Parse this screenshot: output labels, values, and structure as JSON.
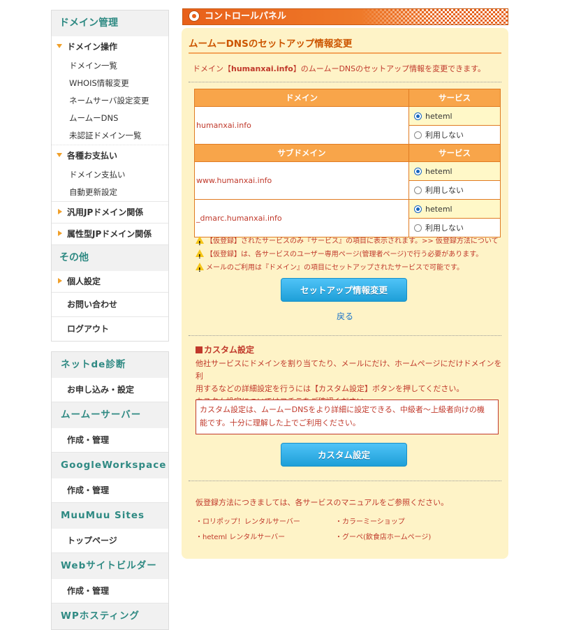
{
  "sidebar": {
    "domain_header": "ドメイン管理",
    "cat_ops": "ドメイン操作",
    "ops_items": [
      "ドメイン一覧",
      "WHOIS情報変更",
      "ネームサーバ設定変更",
      "ムームーDNS",
      "未認証ドメイン一覧"
    ],
    "cat_payment": "各種お支払い",
    "payment_items": [
      "ドメイン支払い",
      "自動更新設定"
    ],
    "cat_jp": "汎用JPドメイン関係",
    "cat_attr_jp": "属性型JPドメイン関係",
    "other_header": "その他",
    "cat_personal": "個人設定",
    "contact": "お問い合わせ",
    "logout": "ログアウト",
    "services": [
      {
        "header": "ネットde診断",
        "item": "お申し込み・設定"
      },
      {
        "header": "ムームーサーバー",
        "item": "作成・管理"
      },
      {
        "header": "GoogleWorkspace",
        "item": "作成・管理"
      },
      {
        "header": "MuuMuu Sites",
        "item": "トップページ"
      },
      {
        "header": "Webサイトビルダー",
        "item": "作成・管理"
      },
      {
        "header": "WPホスティング",
        "item": ""
      }
    ]
  },
  "main": {
    "bar_title": "コントロールパネル",
    "page_title": "ムームーDNSのセットアップ情報変更",
    "intro_pre": "ドメイン【",
    "intro_domain": "humanxai.info",
    "intro_post": "】のムームーDNSのセットアップ情報を変更できます。",
    "table": {
      "col_domain": "ドメイン",
      "col_service": "サービス",
      "col_subdomain": "サブドメイン",
      "domain": "humanxai.info",
      "subdomains": [
        "www.humanxai.info",
        "_dmarc.humanxai.info"
      ],
      "opt_heteml": "heteml",
      "opt_none": "利用しない"
    },
    "notes": [
      "【仮登録】されたサービスのみ『サービス』の項目に表示されます。>> 仮登録方法について",
      "【仮登録】は、各サービスのユーザー専用ページ(管理者ページ)で行う必要があります。",
      "メールのご利用は『ドメイン』の項目にセットアップされたサービスで可能です。"
    ],
    "submit_label": "セットアップ情報変更",
    "back_label": "戻る",
    "custom": {
      "title": "カスタム設定",
      "desc1": "他社サービスにドメインを割り当てたり、メールにだけ、ホームページにだけドメインを利",
      "desc2": "用するなどの詳細設定を行うには【カスタム設定】ボタンを押してください。",
      "desc3": "カスタム設定についてはコチラをご確認ください。",
      "alert1": "カスタム設定は、ムームーDNSをより詳細に設定できる、中級者～上級者向けの機",
      "alert2": "能です。十分に理解した上でご利用ください。",
      "button": "カスタム設定"
    },
    "guide": "仮登録方法につきましては、各サービスのマニュアルをご参照ください。",
    "links_left": [
      "・ロリポップ！レンタルサーバー",
      "・heteml レンタルサーバー"
    ],
    "links_right": [
      "・カラーミーショップ",
      "・グーペ(飲食店ホームページ)"
    ]
  }
}
